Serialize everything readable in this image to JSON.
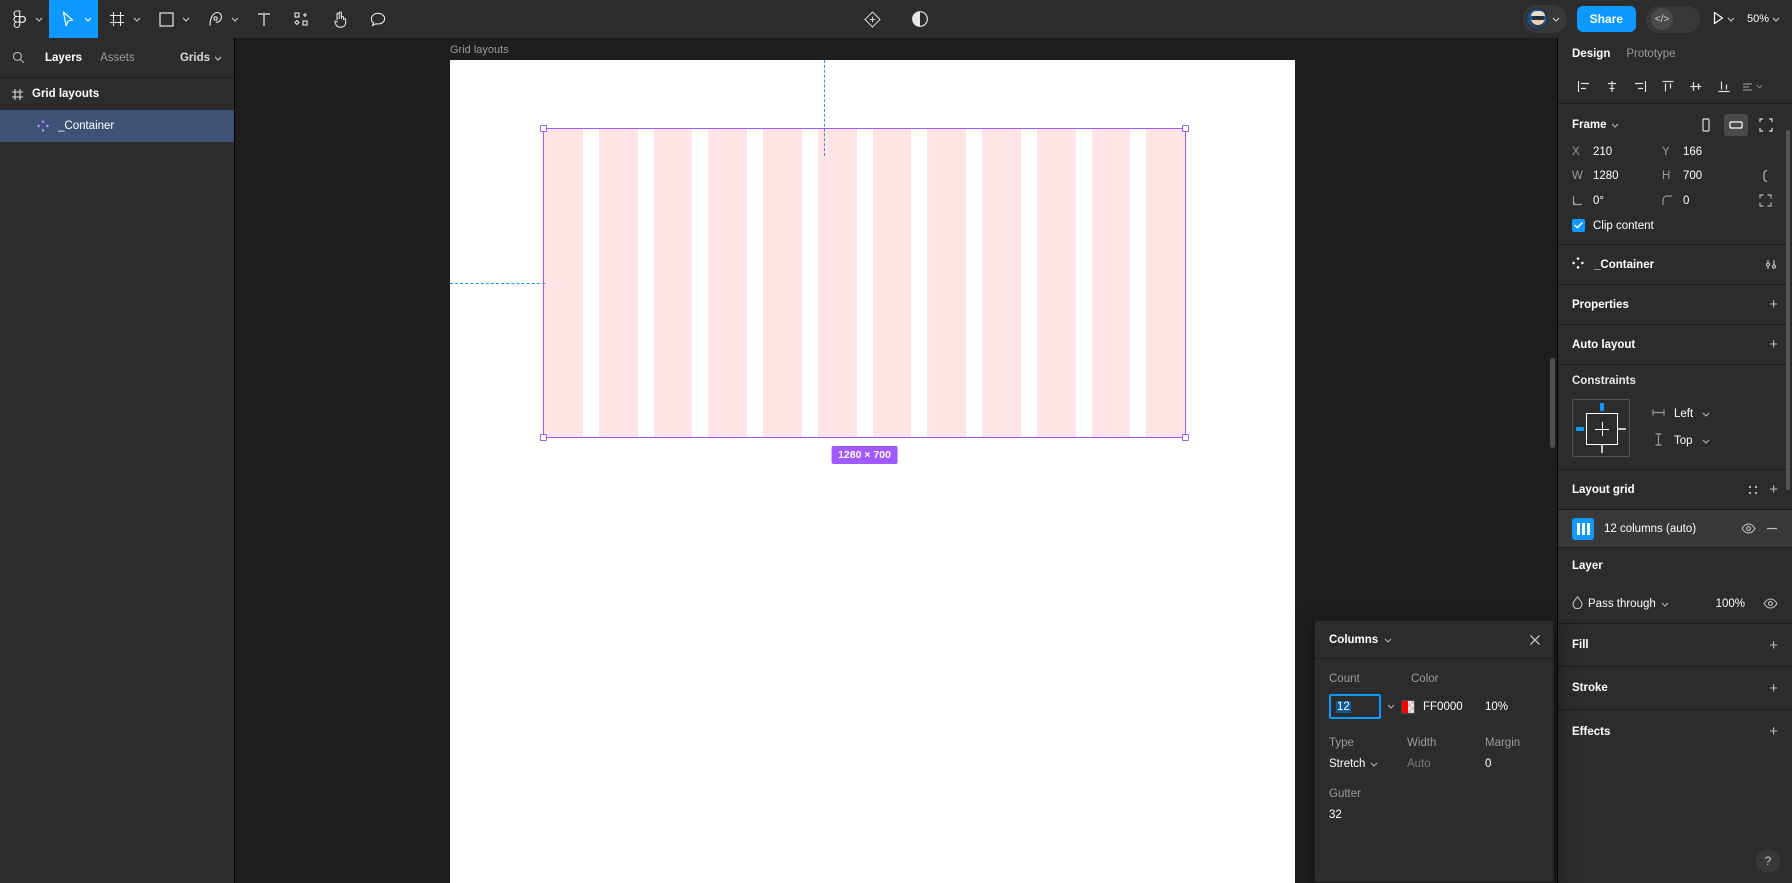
{
  "toolbar": {
    "menu_label": "figma-logo-icon",
    "tools": [
      {
        "name": "main-menu",
        "icon": "figma-logo-icon",
        "caret": true,
        "active": false
      },
      {
        "name": "move-tool",
        "icon": "cursor-icon",
        "caret": true,
        "active": true
      },
      {
        "name": "frame-tool",
        "icon": "frame-icon",
        "caret": true,
        "active": false
      },
      {
        "name": "shape-tool",
        "icon": "square-icon",
        "caret": true,
        "active": false
      },
      {
        "name": "pen-tool",
        "icon": "pen-icon",
        "caret": true,
        "active": false
      },
      {
        "name": "text-tool",
        "icon": "text-icon",
        "caret": false,
        "active": false
      },
      {
        "name": "resources-tool",
        "icon": "components-icon",
        "caret": false,
        "active": false
      },
      {
        "name": "hand-tool",
        "icon": "hand-icon",
        "caret": false,
        "active": false
      },
      {
        "name": "comment-tool",
        "icon": "comment-icon",
        "caret": false,
        "active": false
      }
    ],
    "center_actions": [
      {
        "name": "actions-button",
        "icon": "diamond-plus-icon"
      },
      {
        "name": "dark-mode-toggle",
        "icon": "contrast-icon"
      }
    ],
    "share_label": "Share",
    "code_label": "</>",
    "zoom_level": "50%",
    "accent_color": "#0d99ff"
  },
  "left_panel": {
    "search_icon": "search-icon",
    "tabs": [
      {
        "label": "Layers",
        "active": true
      },
      {
        "label": "Assets",
        "active": false
      }
    ],
    "page_selector": "Grids",
    "layers": [
      {
        "label": "Grid layouts",
        "icon": "grid-icon",
        "type": "page",
        "selected": false
      },
      {
        "label": "_Container",
        "icon": "component-icon",
        "type": "component",
        "selected": true
      }
    ]
  },
  "canvas": {
    "frame_label": "Grid layouts",
    "size_badge": "1280 × 700",
    "grid_column_count": 12,
    "grid_color": "#FF0000",
    "grid_opacity": "10%",
    "selection_color": "#a259ff",
    "guide_color": "#1f9cf0"
  },
  "right_panel": {
    "tabs": [
      {
        "label": "Design",
        "active": true
      },
      {
        "label": "Prototype",
        "active": false
      }
    ],
    "align_buttons": [
      "align-left-icon",
      "align-horizontal-center-icon",
      "align-right-icon",
      "align-top-icon",
      "align-vertical-center-icon",
      "align-bottom-icon",
      "distribute-more-icon"
    ],
    "frame": {
      "title": "Frame",
      "view_buttons": [
        "portrait-icon",
        "landscape-icon",
        "fit-icon"
      ],
      "x_label": "X",
      "x_value": "210",
      "y_label": "Y",
      "y_value": "166",
      "w_label": "W",
      "w_value": "1280",
      "h_label": "H",
      "h_value": "700",
      "rotation_label": "angle-icon",
      "rotation_value": "0°",
      "corner_label": "corner-radius-icon",
      "corner_value": "0",
      "proportion_icon": "link-ratio-icon",
      "independent_corners_icon": "independent-corners-icon",
      "clip_content_label": "Clip content",
      "clip_content_checked": true
    },
    "component": {
      "name": "_Container",
      "settings_icon": "component-settings-icon"
    },
    "properties": {
      "title": "Properties",
      "add": "+"
    },
    "auto_layout": {
      "title": "Auto layout",
      "add": "+"
    },
    "constraints": {
      "title": "Constraints",
      "horizontal": "Left",
      "vertical": "Top"
    },
    "layout_grid": {
      "title": "Layout grid",
      "settings_icon": "grid-style-icon",
      "add": "+",
      "items": [
        {
          "label": "12 columns (auto)",
          "visible_icon": "eye-icon",
          "remove_icon": "minus-icon"
        }
      ]
    },
    "layer": {
      "title": "Layer",
      "blend_icon": "blend-mode-icon",
      "blend_mode": "Pass through",
      "opacity": "100%",
      "visibility_icon": "eye-icon"
    },
    "fill": {
      "title": "Fill",
      "add": "+"
    },
    "stroke": {
      "title": "Stroke",
      "add": "+"
    },
    "effects": {
      "title": "Effects",
      "add": "+"
    },
    "help_label": "?"
  },
  "columns_popover": {
    "title": "Columns",
    "close_icon": "close-icon",
    "labels": {
      "count": "Count",
      "color": "Color",
      "type": "Type",
      "width": "Width",
      "margin": "Margin",
      "gutter": "Gutter"
    },
    "count_value": "12",
    "color_hex": "FF0000",
    "color_opacity": "10%",
    "type_value": "Stretch",
    "width_value": "Auto",
    "margin_value": "0",
    "gutter_value": "32"
  }
}
